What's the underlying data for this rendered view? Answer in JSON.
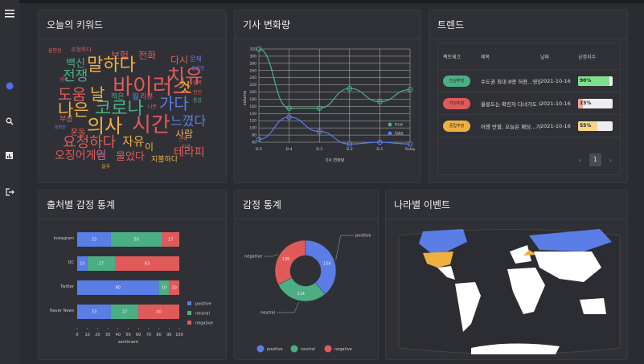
{
  "sidebar": {
    "items": [
      {
        "icon": "menu-icon"
      },
      {
        "icon": "dashboard-icon"
      },
      {
        "icon": "search-icon"
      },
      {
        "icon": "chart-icon"
      },
      {
        "icon": "logout-icon"
      }
    ],
    "accent": "#4f6ee8"
  },
  "panels": {
    "keywords": "오늘의 키워드",
    "volume": "기사 변화량",
    "trend": "트렌드",
    "source": "출처별 감정 통계",
    "sentiment": "감정 통계",
    "country": "나라별 이벤트"
  },
  "wordcloud": [
    {
      "t": "불편함",
      "c": "#e05a5a"
    },
    {
      "t": "조정하다",
      "c": "#e05a5a"
    },
    {
      "t": "보험",
      "c": "#e05a5a"
    },
    {
      "t": "전화",
      "c": "#e05a5a"
    },
    {
      "t": "다시",
      "c": "#e05a5a"
    },
    {
      "t": "문제",
      "c": "#5b7de6"
    },
    {
      "t": "백신",
      "c": "#4caf84"
    },
    {
      "t": "말하다",
      "c": "#f0b040"
    },
    {
      "t": "치유",
      "c": "#e05a5a"
    },
    {
      "t": "실직한",
      "c": "#5b7de6"
    },
    {
      "t": "전쟁",
      "c": "#4caf84"
    },
    {
      "t": "바이러스",
      "c": "#e05a5a"
    },
    {
      "t": "생각",
      "c": "#e05a5a"
    },
    {
      "t": "것",
      "c": "#f0b040"
    },
    {
      "t": "왼쪽",
      "c": "#e05a5a"
    },
    {
      "t": "도움",
      "c": "#e05a5a"
    },
    {
      "t": "날",
      "c": "#f0b040"
    },
    {
      "t": "적은",
      "c": "#4caf84"
    },
    {
      "t": "월",
      "c": "#5b7de6"
    },
    {
      "t": "리뷰",
      "c": "#e05a5a"
    },
    {
      "t": "가다",
      "c": "#5b7de6"
    },
    {
      "t": "안전",
      "c": "#e05a5a"
    },
    {
      "t": "통합",
      "c": "#4caf84"
    },
    {
      "t": "나은",
      "c": "#f0b040"
    },
    {
      "t": "코로나",
      "c": "#4caf84"
    },
    {
      "t": "나쁜",
      "c": "#e05a5a"
    },
    {
      "t": "부상",
      "c": "#e05a5a"
    },
    {
      "t": "의사",
      "c": "#f0b040"
    },
    {
      "t": "시간",
      "c": "#e05a5a"
    },
    {
      "t": "느꼈다",
      "c": "#5b7de6"
    },
    {
      "t": "정확한",
      "c": "#5b7de6"
    },
    {
      "t": "운동",
      "c": "#e05a5a"
    },
    {
      "t": "사람",
      "c": "#f0b040"
    },
    {
      "t": "요청하다",
      "c": "#e05a5a"
    },
    {
      "t": "자유",
      "c": "#f0b040"
    },
    {
      "t": "이",
      "c": "#f0b040"
    },
    {
      "t": "근육",
      "c": "#e05a5a"
    },
    {
      "t": "치명",
      "c": "#e05a5a"
    },
    {
      "t": "테라피",
      "c": "#e05a5a"
    },
    {
      "t": "오징어게임",
      "c": "#e05a5a"
    },
    {
      "t": "접종",
      "c": "#5b7de6"
    },
    {
      "t": "물었다",
      "c": "#e05a5a"
    },
    {
      "t": "지불하다",
      "c": "#f0b040"
    },
    {
      "t": "실수",
      "c": "#f0b040"
    }
  ],
  "trend": {
    "headers": [
      "팩트체크",
      "제목",
      "날짜",
      "긍정지수"
    ],
    "rows": [
      {
        "badge": "진실추정",
        "badge_color": "#4caf84",
        "title": "수도권 최대 8명 허용...영업시간",
        "date": "2021-10-16",
        "score": 90,
        "score_label": "90%",
        "fill": "#7ee08f"
      },
      {
        "badge": "거짓추정",
        "badge_color": "#e05a5a",
        "title": "울릉도는 확진자 다녀가도 확진",
        "date": "2021-10-16",
        "score": 15,
        "score_label": "15%",
        "fill": "#f0a5a0"
      },
      {
        "badge": "중립추정",
        "badge_color": "#f0b040",
        "title": "어젠 반팔, 오늘은 패딩…가을!",
        "date": "2021-10-16",
        "score": 55,
        "score_label": "55%",
        "fill": "#f5d58a"
      }
    ],
    "page": "1",
    "prev": "‹",
    "next": "›"
  },
  "chart_data": [
    {
      "type": "line",
      "title": "기사 변화량",
      "xlabel": "기사 변화량",
      "ylabel": "volume",
      "categories": [
        "D-5",
        "D-4",
        "D-3",
        "D-2",
        "D-1",
        "Today"
      ],
      "ylim": [
        60,
        320
      ],
      "yticks": [
        "60",
        "80",
        "100",
        "120",
        "140",
        "160",
        "180",
        "200",
        "220",
        "240",
        "260",
        "280",
        "300",
        "320"
      ],
      "series": [
        {
          "name": "true",
          "color": "#4caf84",
          "values": [
            320,
            155,
            155,
            210,
            173,
            207
          ]
        },
        {
          "name": "fake",
          "color": "#5b7de6",
          "values": [
            68,
            130,
            90,
            55,
            60,
            55
          ]
        }
      ]
    },
    {
      "type": "bar",
      "stacked": true,
      "horizontal": true,
      "xlabel": "sentiment",
      "categories": [
        "Instagram",
        "DC",
        "Twitter",
        "Naver News"
      ],
      "xlim": [
        0,
        100
      ],
      "xticks": [
        "0",
        "10",
        "20",
        "30",
        "40",
        "50",
        "60",
        "70",
        "80",
        "90",
        "100"
      ],
      "series": [
        {
          "name": "positive",
          "color": "#5b7de6",
          "values": [
            33,
            10,
            80,
            33
          ],
          "labels": [
            "33",
            "10",
            "80",
            "33"
          ]
        },
        {
          "name": "neutral",
          "color": "#4caf84",
          "values": [
            50,
            27,
            10,
            27
          ],
          "labels": [
            "50",
            "27",
            "10",
            "27"
          ]
        },
        {
          "name": "negative",
          "color": "#e05a5a",
          "values": [
            17,
            63,
            10,
            40
          ],
          "labels": [
            "17",
            "63",
            "10",
            "40"
          ]
        }
      ]
    },
    {
      "type": "pie",
      "donut": true,
      "categories": [
        "positive",
        "neutral",
        "negative"
      ],
      "values": [
        156,
        114,
        130
      ],
      "labels": [
        "156",
        "114",
        "130"
      ],
      "colors": [
        "#5b7de6",
        "#4caf84",
        "#e05a5a"
      ]
    }
  ]
}
